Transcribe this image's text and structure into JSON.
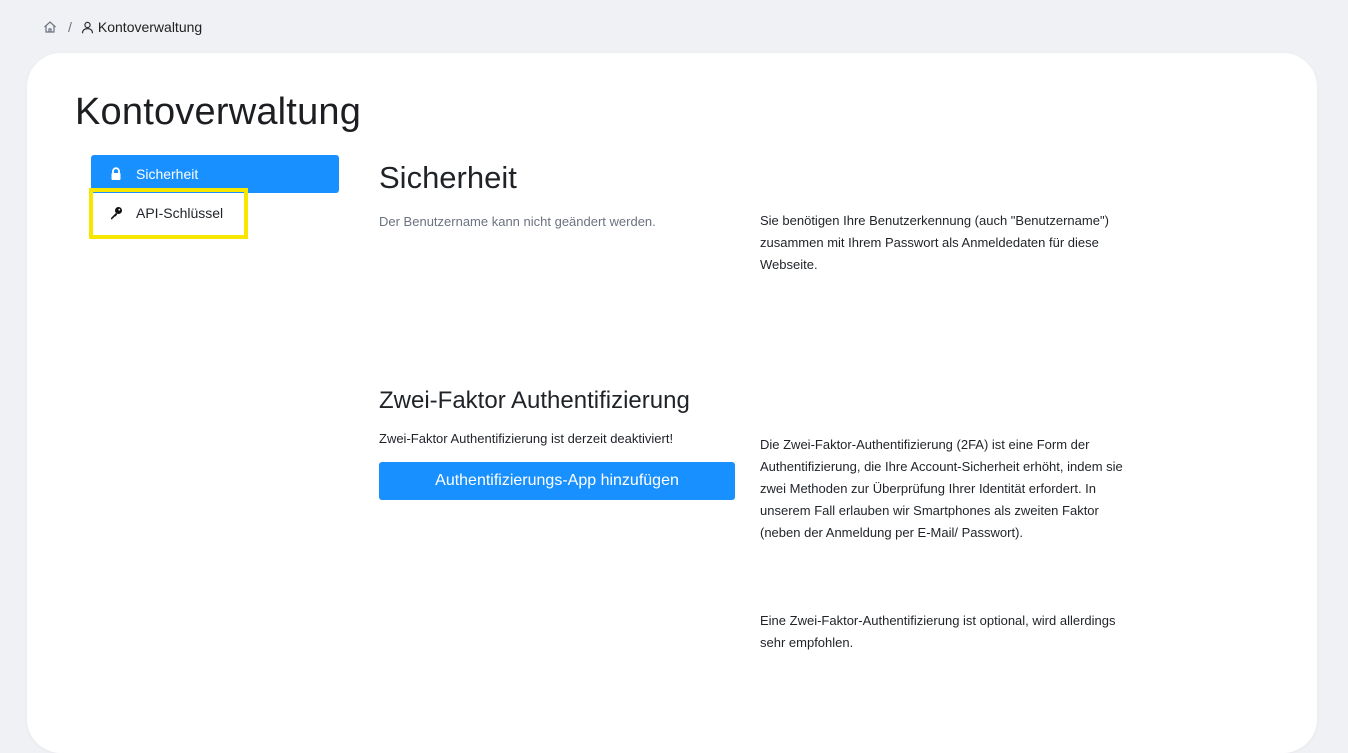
{
  "breadcrumb": {
    "home_icon": "home-icon",
    "separator": "/",
    "user_icon": "user-icon",
    "current": "Kontoverwaltung"
  },
  "page": {
    "title": "Kontoverwaltung"
  },
  "sidebar": {
    "items": [
      {
        "label": "Sicherheit",
        "icon": "lock-icon",
        "active": true
      },
      {
        "label": "API-Schlüssel",
        "icon": "key-icon",
        "active": false,
        "highlighted": true
      }
    ]
  },
  "security": {
    "title": "Sicherheit",
    "username_note": "Der Benutzername kann nicht geändert werden.",
    "description": "Sie benötigen Ihre Benutzerkennung (auch \"Benutzername\") zusammen mit Ihrem Passwort als Anmeldedaten für diese Webseite."
  },
  "two_factor": {
    "title": "Zwei-Faktor Authentifizierung",
    "status": "Zwei-Faktor Authentifizierung ist derzeit deaktiviert!",
    "add_button_label": "Authentifizierungs-App hinzufügen",
    "description_1": "Die Zwei-Faktor-Authentifizierung (2FA) ist eine Form der Authentifizierung, die Ihre Account-Sicherheit erhöht, indem sie zwei Methoden zur Überprüfung Ihrer Identität erfordert. In unserem Fall erlauben wir Smartphones als zweiten Faktor (neben der Anmeldung per E-Mail/ Passwort).",
    "description_2": "Eine Zwei-Faktor-Authentifizierung ist optional, wird allerdings sehr empfohlen."
  },
  "colors": {
    "primary": "#1890ff",
    "highlight": "#f6e600",
    "background": "#f0f1f4",
    "card": "#ffffff"
  }
}
